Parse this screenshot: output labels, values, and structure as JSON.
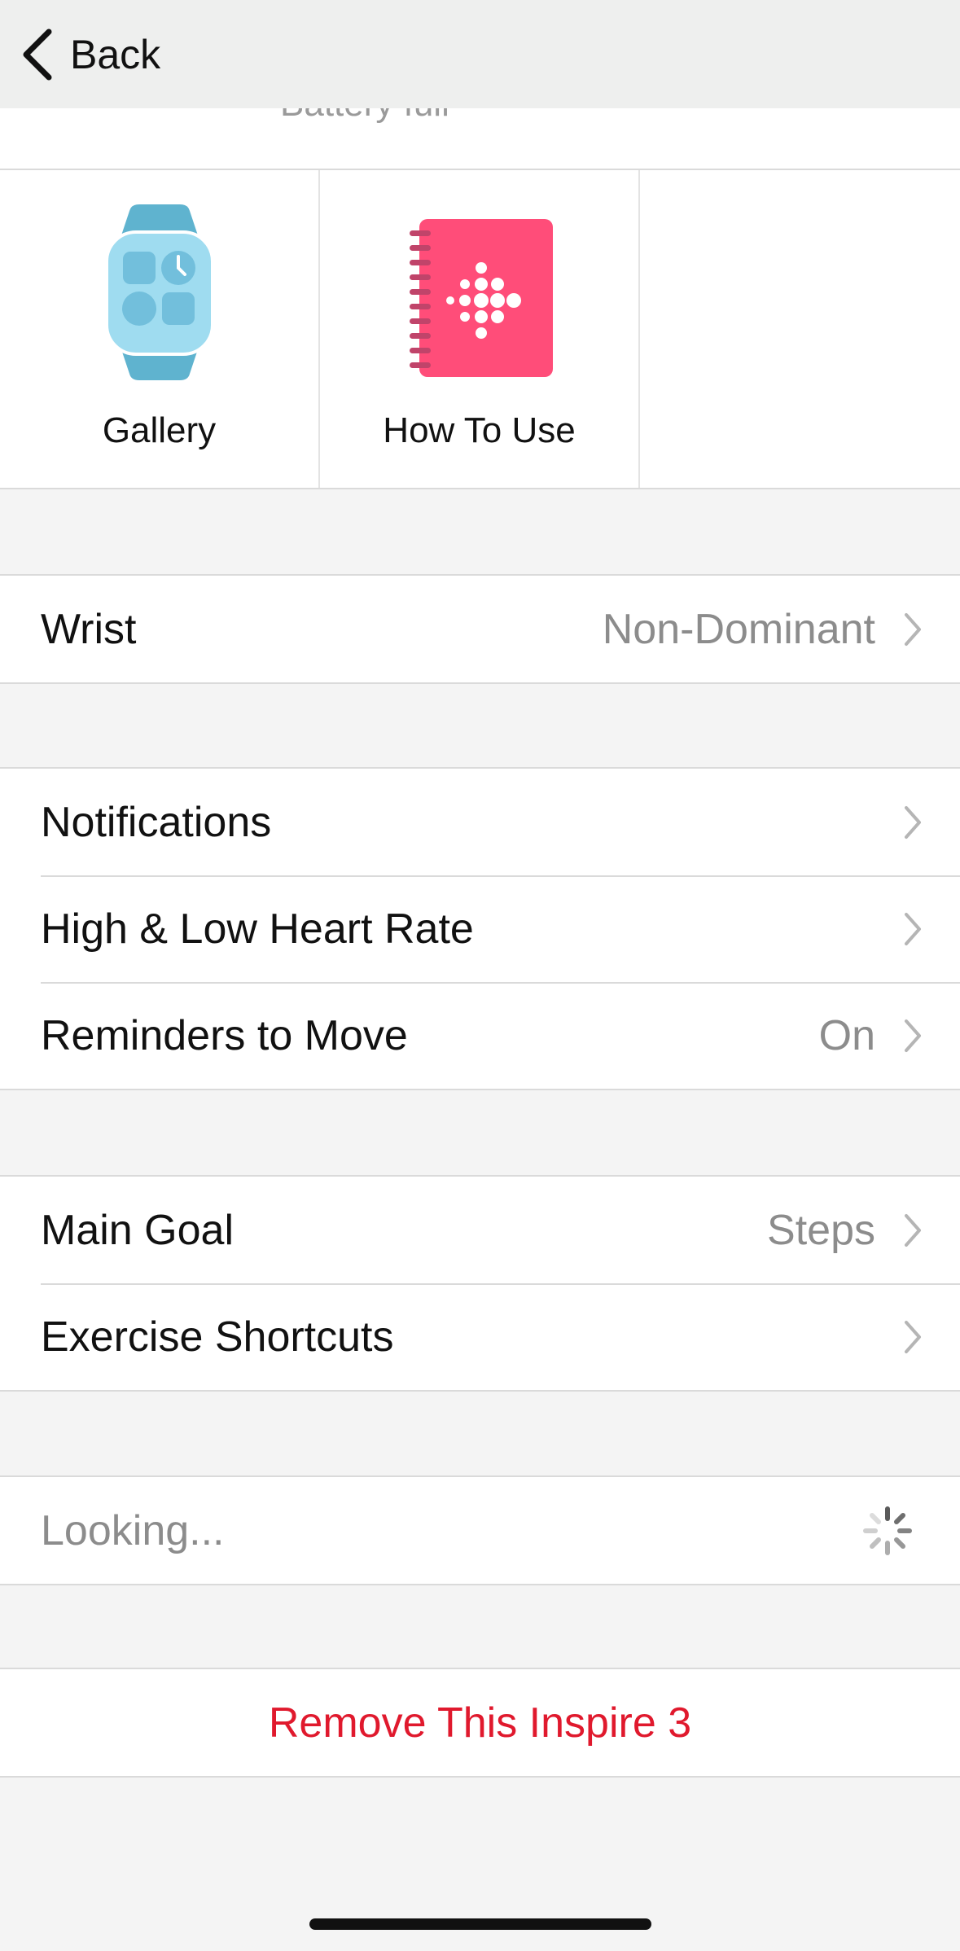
{
  "nav": {
    "back_label": "Back"
  },
  "scrolled_under": {
    "text": "Battery full"
  },
  "tiles": [
    {
      "label": "Gallery",
      "icon": "watch-gallery-icon"
    },
    {
      "label": "How To Use",
      "icon": "guide-book-icon"
    }
  ],
  "wrist": {
    "label": "Wrist",
    "value": "Non-Dominant"
  },
  "notifications_group": [
    {
      "label": "Notifications",
      "value": ""
    },
    {
      "label": "High & Low Heart Rate",
      "value": ""
    },
    {
      "label": "Reminders to Move",
      "value": "On"
    }
  ],
  "goals_group": [
    {
      "label": "Main Goal",
      "value": "Steps"
    },
    {
      "label": "Exercise Shortcuts",
      "value": ""
    }
  ],
  "looking": {
    "label": "Looking..."
  },
  "remove": {
    "label": "Remove This Inspire 3"
  },
  "colors": {
    "accent_red": "#e0192d",
    "guide_pink": "#ff4d79",
    "watch_blue": "#5fb3cf",
    "secondary_text": "#8c8c8c"
  }
}
